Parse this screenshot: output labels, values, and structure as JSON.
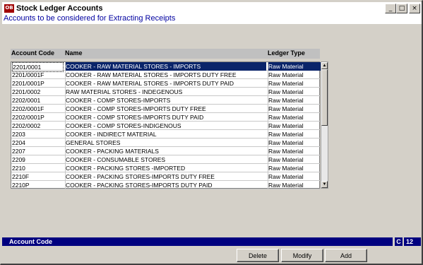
{
  "window": {
    "title": "Stock Ledger Accounts",
    "icon_text": "OB",
    "controls": {
      "minimize": "_",
      "maximize": "□",
      "close": "×"
    }
  },
  "header": {
    "caption": "Accounts to be considered for Extracting Receipts"
  },
  "grid": {
    "columns": [
      "Account Code",
      "Name",
      "Ledger Type"
    ],
    "selected_index": 0,
    "rows": [
      {
        "code": "2201/0001",
        "name": "COOKER - RAW MATERIAL STORES - IMPORTS",
        "type": "Raw Material"
      },
      {
        "code": "2201/0001F",
        "name": "COOKER - RAW MATERIAL STORES - IMPORTS DUTY FREE",
        "type": "Raw Material"
      },
      {
        "code": "2201/0001P",
        "name": "COOKER - RAW MATERIAL STORES - IMPORTS DUTY PAID",
        "type": "Raw Material"
      },
      {
        "code": "2201/0002",
        "name": "RAW MATERIAL STORES - INDEGENOUS",
        "type": "Raw Material"
      },
      {
        "code": "2202/0001",
        "name": "COOKER - COMP STORES-IMPORTS",
        "type": "Raw Material"
      },
      {
        "code": "2202/0001F",
        "name": "COOKER - COMP STORES-IMPORTS DUTY FREE",
        "type": "Raw Material"
      },
      {
        "code": "2202/0001P",
        "name": "COOKER - COMP STORES-IMPORTS DUTY PAID",
        "type": "Raw Material"
      },
      {
        "code": "2202/0002",
        "name": "COOKER - COMP STORES-INDIGENOUS",
        "type": "Raw Material"
      },
      {
        "code": "2203",
        "name": "COOKER - INDIRECT MATERIAL",
        "type": "Raw Material"
      },
      {
        "code": "2204",
        "name": "GENERAL STORES",
        "type": "Raw Material"
      },
      {
        "code": "2207",
        "name": "COOKER - PACKING MATERIALS",
        "type": "Raw Material"
      },
      {
        "code": "2209",
        "name": "COOKER - CONSUMABLE STORES",
        "type": "Raw Material"
      },
      {
        "code": "2210",
        "name": "COOKER - PACKING STORES -IMPORTED",
        "type": "Raw Material"
      },
      {
        "code": "2210F",
        "name": "COOKER - PACKING STORES-IMPORTS DUTY FREE",
        "type": "Raw Material"
      },
      {
        "code": "2210P",
        "name": "COOKER - PACKING STORES-IMPORTS DUTY PAID",
        "type": "Raw Material"
      }
    ]
  },
  "scrollbar": {
    "up": "▲",
    "down": "▼"
  },
  "status": {
    "label": "Account Code",
    "mode": "C",
    "count": "12"
  },
  "buttons": {
    "delete": "Delete",
    "modify": "Modify",
    "add": "Add"
  }
}
